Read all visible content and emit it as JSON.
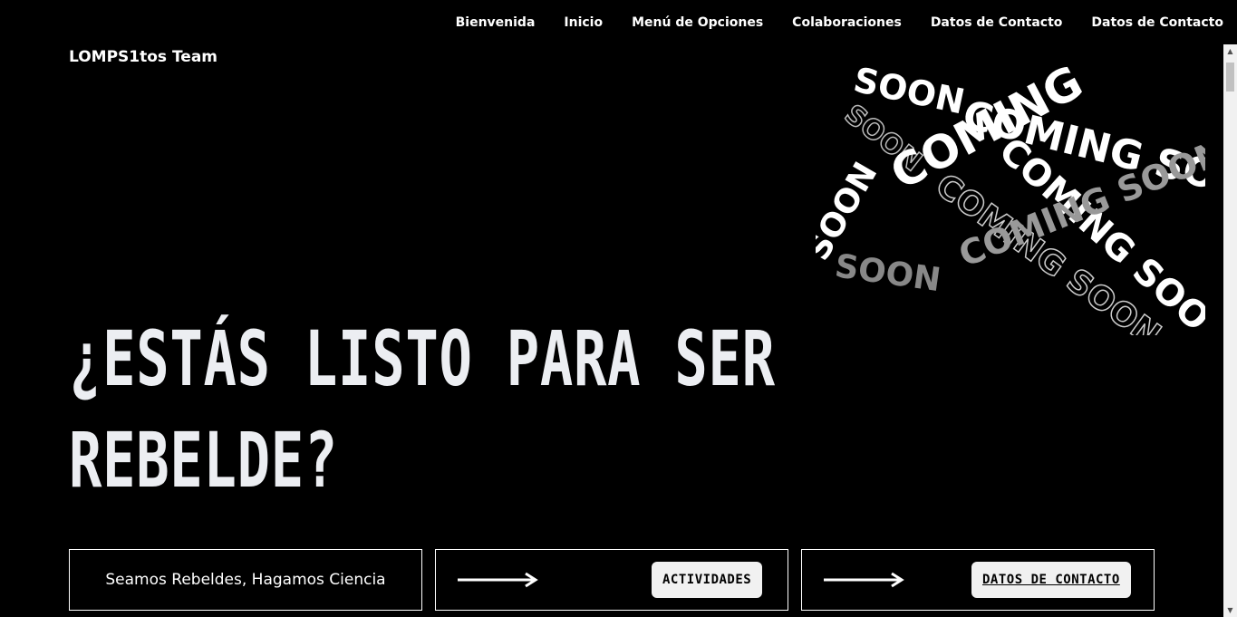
{
  "nav": {
    "items": [
      "Bienvenida",
      "Inicio",
      "Menú de Opciones",
      "Colaboraciones",
      "Datos de Contacto",
      "Datos de Contacto"
    ]
  },
  "brand": {
    "name": "LOMPS1tos Team"
  },
  "hero": {
    "line1": "¿Estás listo para ser",
    "line2": "Rebelde?"
  },
  "art": {
    "text": "COMING SOON"
  },
  "cards": {
    "slogan": "Seamos Rebeldes, Hagamos Ciencia",
    "activities_label": "Actividades",
    "contact_label": "Datos de Contacto"
  },
  "scroll": {
    "up": "▲",
    "down": "▼"
  },
  "colors": {
    "background": "#000000",
    "text": "#ffffff",
    "pill": "#f1f1f1"
  }
}
